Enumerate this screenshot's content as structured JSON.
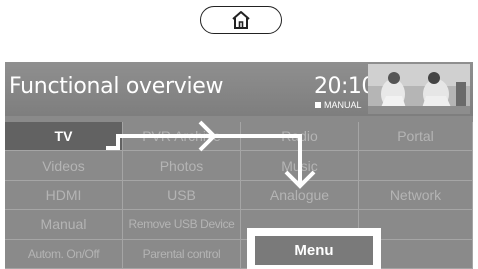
{
  "home_button": {
    "icon": "home-icon"
  },
  "header": {
    "title": "Functional overview",
    "clock": "20:10",
    "mode_badge": "MANUAL",
    "preview": "tv-preview-thumbnail"
  },
  "grid": {
    "rows": [
      [
        "TV",
        "PVR Archive",
        "Radio",
        "Portal"
      ],
      [
        "Videos",
        "Photos",
        "Music",
        ""
      ],
      [
        "HDMI",
        "USB",
        "Analogue",
        "Network"
      ],
      [
        "Manual",
        "Remove USB Device",
        "",
        ""
      ],
      [
        "Autom. On/Off",
        "Parental control",
        "",
        ""
      ]
    ],
    "selected": "TV"
  },
  "popup": {
    "menu_label": "Menu"
  },
  "colors": {
    "background": "#8a8a8a",
    "selected_cell": "#626262",
    "cell_text": "#b4b4b4",
    "overlay": "#ffffff"
  }
}
